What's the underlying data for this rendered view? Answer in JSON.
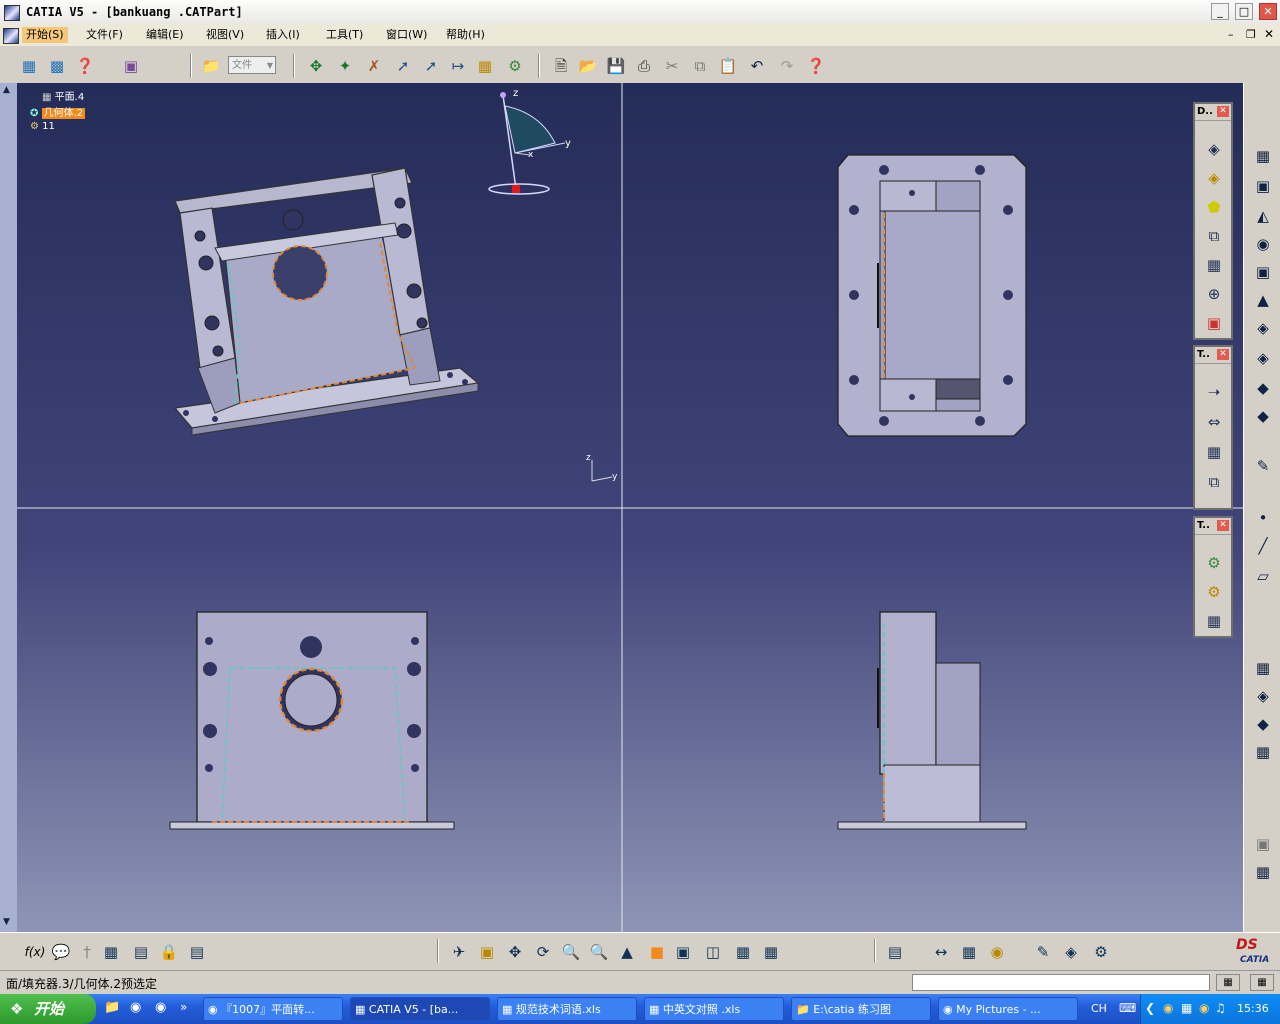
{
  "window": {
    "title": "CATIA V5 - [bankuang .CATPart]",
    "min_glyph": "_",
    "max_glyph": "□",
    "close_glyph": "✕"
  },
  "menu": {
    "items": [
      "开始(S)",
      "文件(F)",
      "编辑(E)",
      "视图(V)",
      "插入(I)",
      "工具(T)",
      "窗口(W)",
      "帮助(H)"
    ],
    "active_index": 0
  },
  "toolbar": {
    "file_combo_value": "文件"
  },
  "tree": {
    "items": [
      "平面.4",
      "几何体.2",
      "11"
    ]
  },
  "compass": {
    "axis_z": "z",
    "axis_y": "y",
    "axis_x": "x"
  },
  "axis_triad": {
    "z": "z",
    "y": "y"
  },
  "palettes": {
    "palette1_title": "D..",
    "palette2_title": "T..",
    "palette3_title": "T..",
    "close_glyph": "✕"
  },
  "bottom_toolbar": {
    "formula_label": "f(x)"
  },
  "status": {
    "message": "面/填充器.3/几何体.2预选定"
  },
  "brand": {
    "logo_text": "CATIA"
  },
  "taskbar": {
    "start_label": "开始",
    "tasks": [
      {
        "label": "『1007』平面转..."
      },
      {
        "label": "CATIA V5 - [ba..."
      },
      {
        "label": "规范技术词语.xls"
      },
      {
        "label": "中英文对照 .xls"
      },
      {
        "label": "E:\\catia 练习图"
      },
      {
        "label": "My Pictures - ..."
      }
    ],
    "active_task": 1,
    "lang": "CH",
    "clock": "15:36"
  },
  "colors": {
    "viewport_top": "#242c58",
    "viewport_bottom": "#8e95b5",
    "part_face": "#a9a9c8",
    "edge_orange": "#e08a3c",
    "edge_cyan": "#5ec8c8",
    "highlight_orange": "#f28a1d"
  }
}
